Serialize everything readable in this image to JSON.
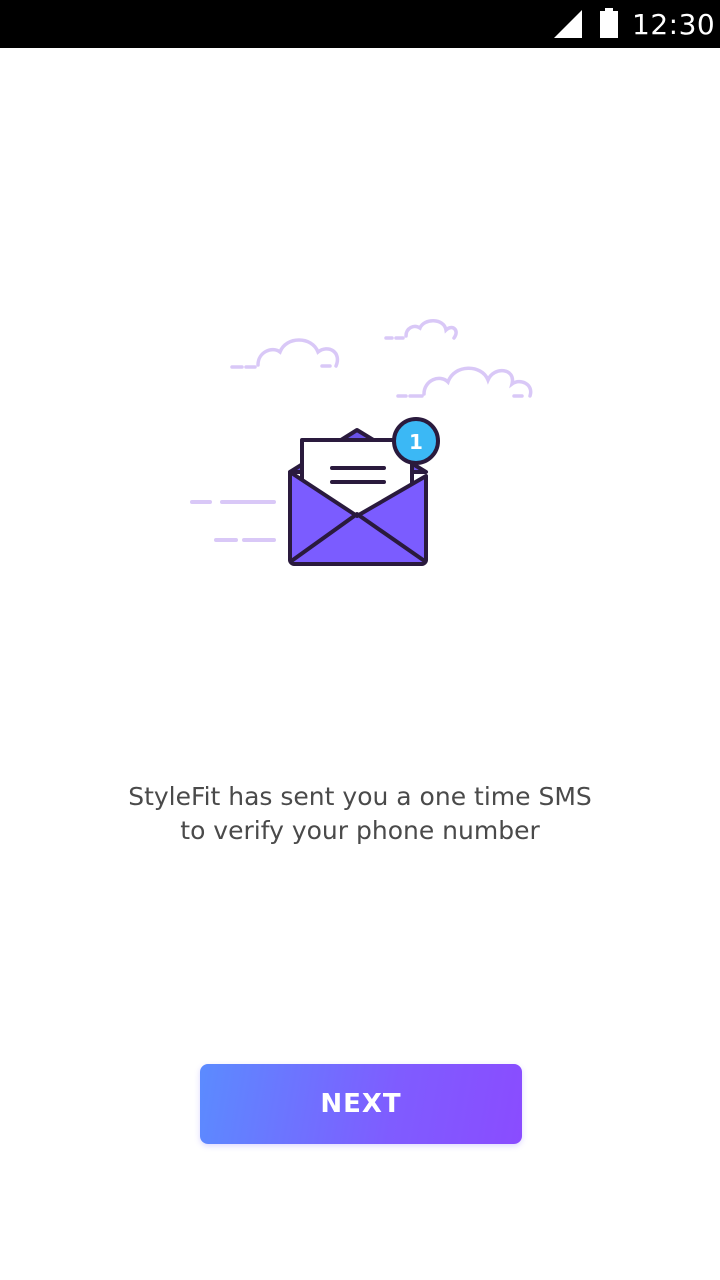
{
  "status_bar": {
    "time": "12:30",
    "signal_icon": "cell-signal-icon",
    "battery_icon": "battery-icon"
  },
  "illustration": {
    "icon": "envelope-notification-icon",
    "badge_count": "1",
    "colors": {
      "envelope": "#7b5cff",
      "outline": "#2a1a3d",
      "badge": "#3bb8f5",
      "clouds": "#d9c8f7"
    }
  },
  "message": {
    "line1": "StyleFit has sent you a one time SMS",
    "line2": "to verify your phone number"
  },
  "next_button": {
    "label": "NEXT",
    "gradient_start": "#5b8bff",
    "gradient_end": "#8a4cff"
  }
}
